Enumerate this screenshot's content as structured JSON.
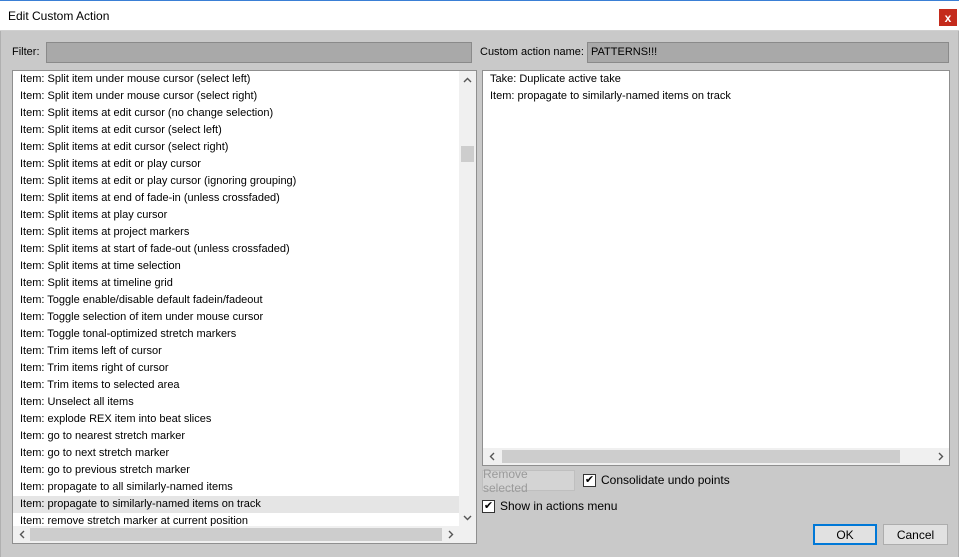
{
  "window": {
    "title": "Edit Custom Action",
    "close_glyph": "x"
  },
  "filter": {
    "label": "Filter:",
    "value": ""
  },
  "custom_action": {
    "label": "Custom action name:",
    "value": "PATTERNS!!!"
  },
  "actions_list": {
    "items": [
      "Item: Split item under mouse cursor (select left)",
      "Item: Split item under mouse cursor (select right)",
      "Item: Split items at edit cursor (no change selection)",
      "Item: Split items at edit cursor (select left)",
      "Item: Split items at edit cursor (select right)",
      "Item: Split items at edit or play cursor",
      "Item: Split items at edit or play cursor (ignoring grouping)",
      "Item: Split items at end of fade-in (unless crossfaded)",
      "Item: Split items at play cursor",
      "Item: Split items at project markers",
      "Item: Split items at start of fade-out (unless crossfaded)",
      "Item: Split items at time selection",
      "Item: Split items at timeline grid",
      "Item: Toggle enable/disable default fadein/fadeout",
      "Item: Toggle selection of item under mouse cursor",
      "Item: Toggle tonal-optimized stretch markers",
      "Item: Trim items left of cursor",
      "Item: Trim items right of cursor",
      "Item: Trim items to selected area",
      "Item: Unselect all items",
      "Item: explode REX item into beat slices",
      "Item: go to nearest stretch marker",
      "Item: go to next stretch marker",
      "Item: go to previous stretch marker",
      "Item: propagate to all similarly-named items",
      "Item: propagate to similarly-named items on track",
      "Item: remove stretch marker at current position"
    ],
    "selected_index": 25
  },
  "custom_list": {
    "items": [
      "Take: Duplicate active take",
      "Item: propagate to similarly-named items on track"
    ]
  },
  "buttons": {
    "remove_selected": "Remove selected",
    "ok": "OK",
    "cancel": "Cancel"
  },
  "checks": {
    "consolidate_label": "Consolidate undo points",
    "consolidate_checked": true,
    "show_menu_label": "Show in actions menu",
    "show_menu_checked": true,
    "check_glyph": "✔"
  },
  "icons": {
    "up": "chevron-up-icon",
    "down": "chevron-down-icon",
    "left": "chevron-left-icon",
    "right": "chevron-right-icon"
  }
}
